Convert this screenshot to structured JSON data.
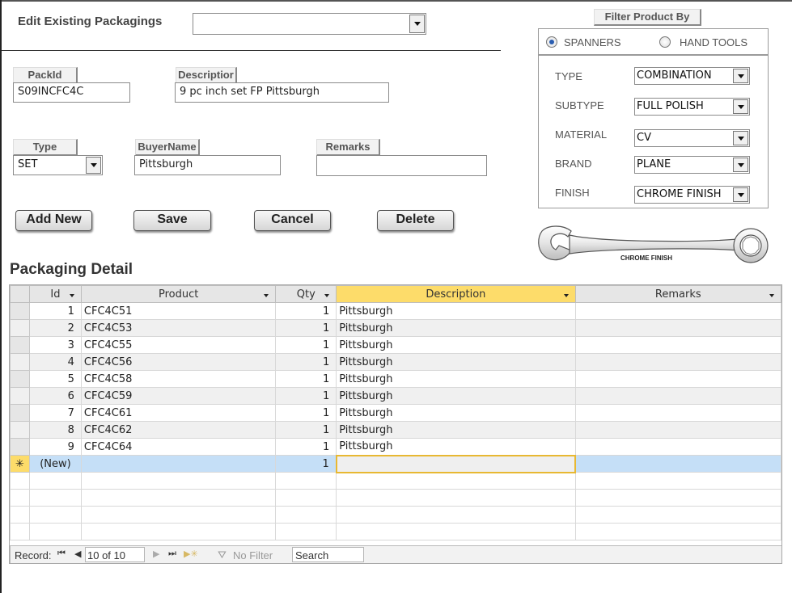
{
  "header": {
    "title": "Edit Existing Packagings",
    "select_value": ""
  },
  "form": {
    "packid": {
      "label": "PackId",
      "value": "S09INCFC4C"
    },
    "description": {
      "label": "Descriptior",
      "value": "9 pc inch set FP Pittsburgh"
    },
    "type": {
      "label": "Type",
      "value": "SET"
    },
    "buyername": {
      "label": "BuyerName",
      "value": "Pittsburgh"
    },
    "remarks": {
      "label": "Remarks",
      "value": ""
    }
  },
  "buttons": {
    "add_new": "Add New",
    "save": "Save",
    "cancel": "Cancel",
    "delete": "Delete"
  },
  "filter": {
    "title": "Filter Product By",
    "options": [
      {
        "label": "SPANNERS",
        "selected": true
      },
      {
        "label": "HAND TOOLS",
        "selected": false
      }
    ],
    "fields": [
      {
        "label": "TYPE",
        "value": "COMBINATION"
      },
      {
        "label": "SUBTYPE",
        "value": "FULL POLISH"
      },
      {
        "label": "MATERIAL",
        "value": "CV"
      },
      {
        "label": "BRAND",
        "value": "PLANE"
      },
      {
        "label": "FINISH",
        "value": "CHROME FINISH"
      }
    ],
    "image_caption": "CHROME FINISH"
  },
  "detail": {
    "title": "Packaging Detail",
    "columns": [
      "Id",
      "Product",
      "Qty",
      "Description",
      "Remarks"
    ],
    "rows": [
      {
        "id": "1",
        "product": "CFC4C51",
        "qty": "1",
        "description": "Pittsburgh",
        "remarks": ""
      },
      {
        "id": "2",
        "product": "CFC4C53",
        "qty": "1",
        "description": "Pittsburgh",
        "remarks": ""
      },
      {
        "id": "3",
        "product": "CFC4C55",
        "qty": "1",
        "description": "Pittsburgh",
        "remarks": ""
      },
      {
        "id": "4",
        "product": "CFC4C56",
        "qty": "1",
        "description": "Pittsburgh",
        "remarks": ""
      },
      {
        "id": "5",
        "product": "CFC4C58",
        "qty": "1",
        "description": "Pittsburgh",
        "remarks": ""
      },
      {
        "id": "6",
        "product": "CFC4C59",
        "qty": "1",
        "description": "Pittsburgh",
        "remarks": ""
      },
      {
        "id": "7",
        "product": "CFC4C61",
        "qty": "1",
        "description": "Pittsburgh",
        "remarks": ""
      },
      {
        "id": "8",
        "product": "CFC4C62",
        "qty": "1",
        "description": "Pittsburgh",
        "remarks": ""
      },
      {
        "id": "9",
        "product": "CFC4C64",
        "qty": "1",
        "description": "Pittsburgh",
        "remarks": ""
      }
    ],
    "new_row": {
      "id": "(New)",
      "qty": "1"
    },
    "new_row_marker": "✳"
  },
  "navigation": {
    "record_label": "Record:",
    "record_value": "10 of 10",
    "filter_label": "No Filter",
    "search_value": "Search",
    "icons": [
      "first-record-icon",
      "previous-record-icon",
      "next-record-icon",
      "last-record-icon",
      "new-record-icon",
      "filter-icon"
    ]
  },
  "colors": {
    "selected_header": "#fddc6a",
    "new_row": "#c5dff7",
    "alt_row": "#f0f0f0"
  }
}
